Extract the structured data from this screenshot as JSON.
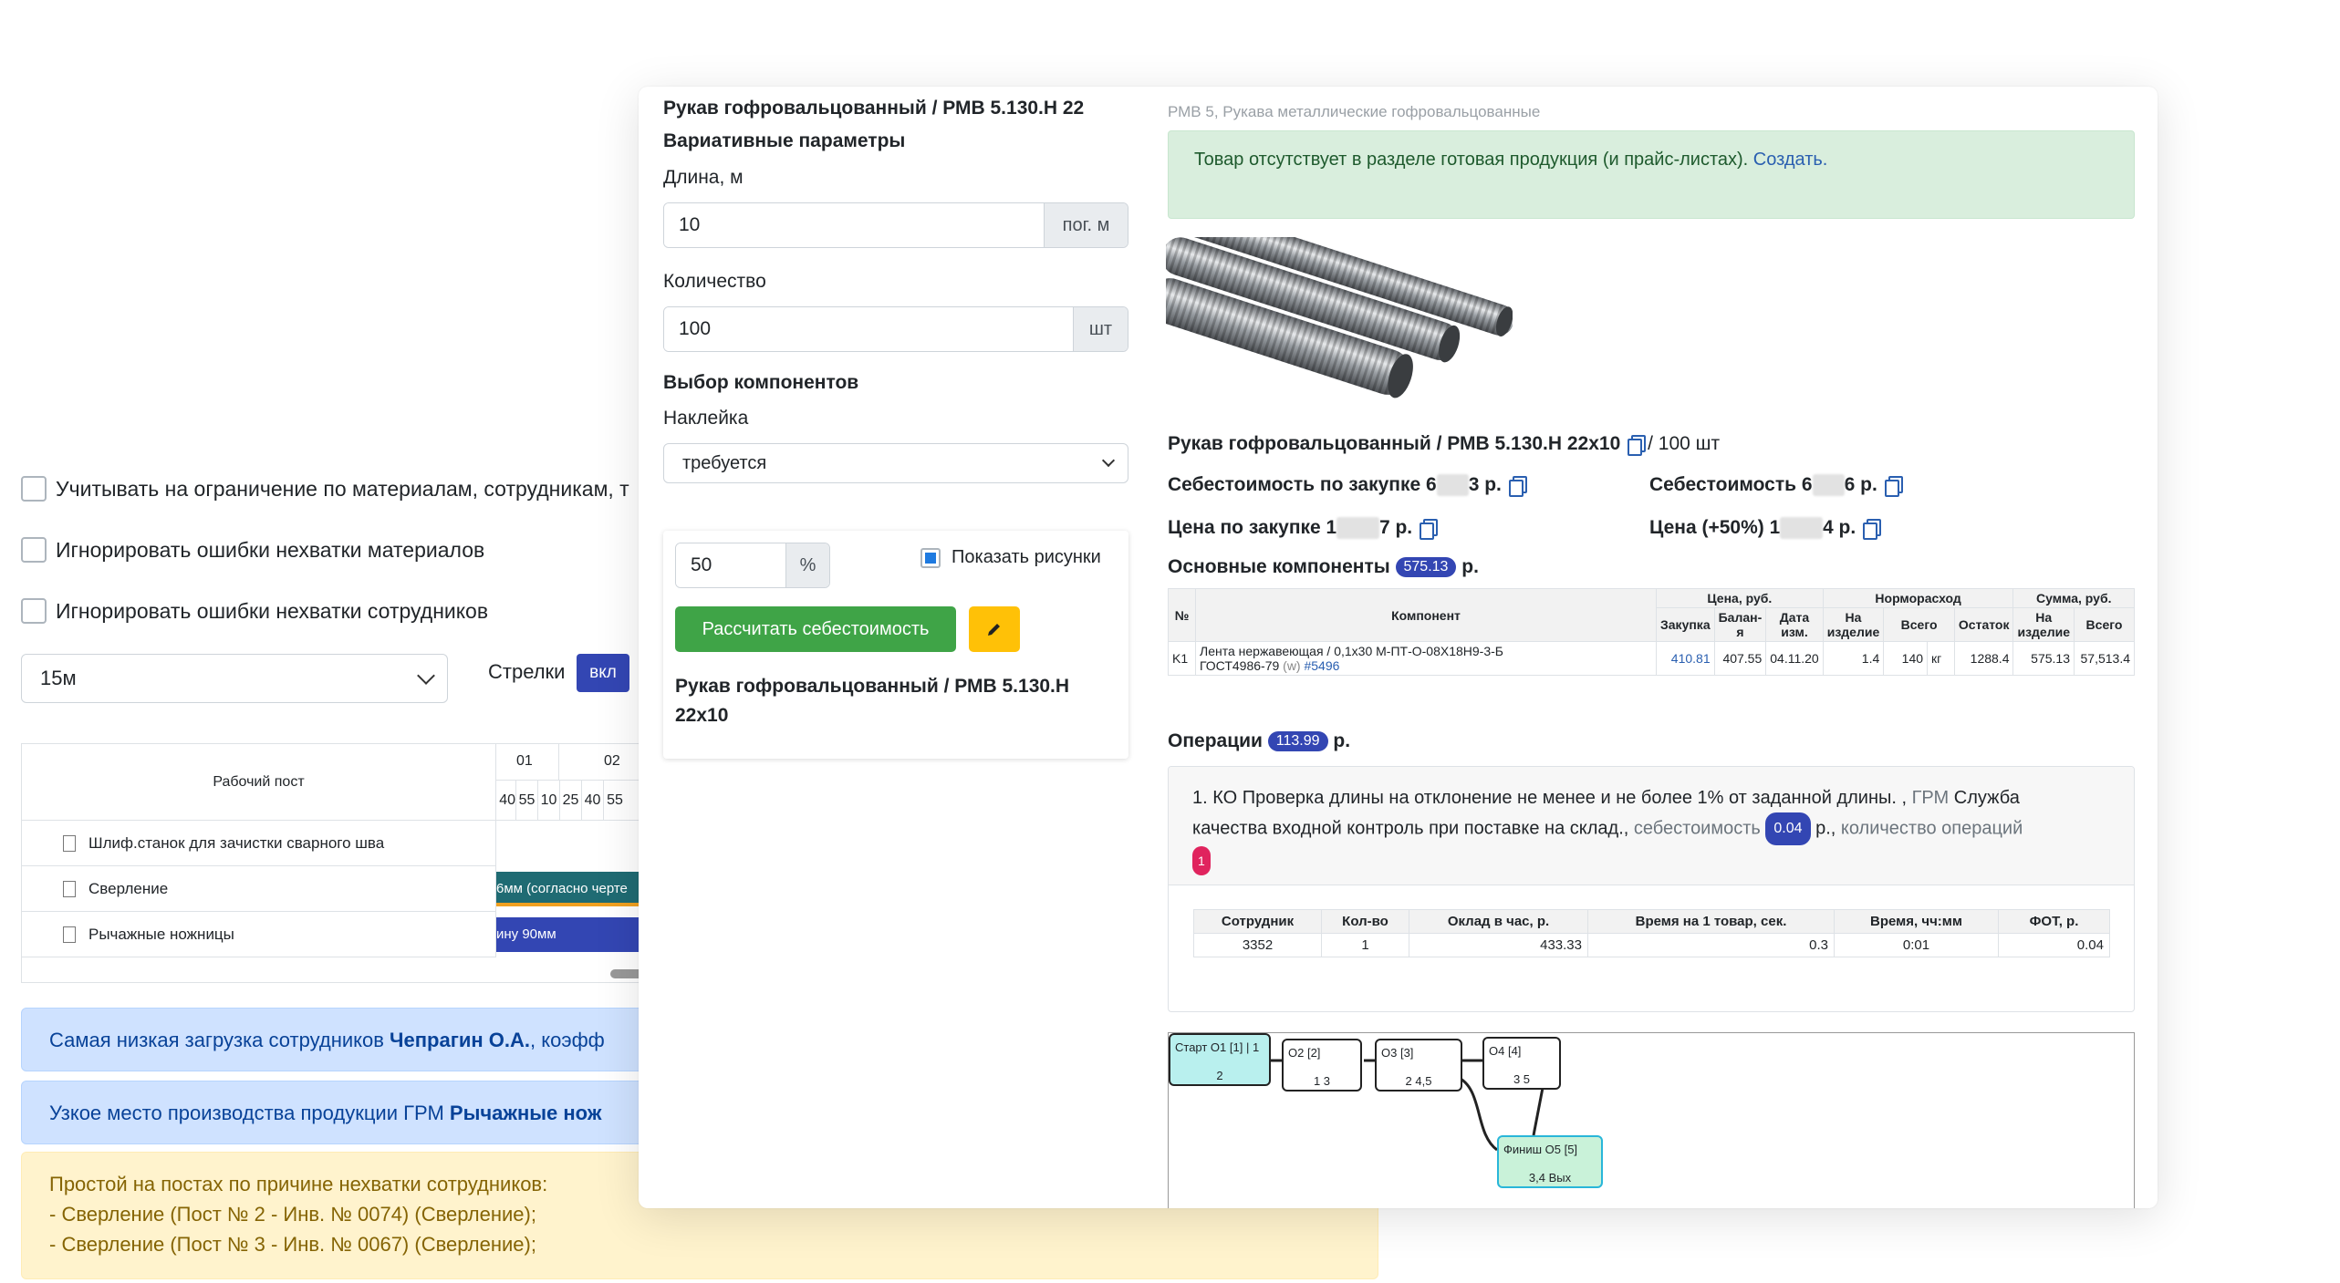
{
  "background": {
    "checkboxes": [
      "Учитывать на ограничение по материалам, сотрудникам, т",
      "Игнорировать ошибки нехватки материалов",
      "Игнорировать ошибки нехватки сотрудников"
    ],
    "interval_select": "15м",
    "arrows_label": "Стрелки",
    "arrows_toggle": "вкл",
    "gantt": {
      "header": "Рабочий пост",
      "hours": [
        "01",
        "02"
      ],
      "minutes": [
        "40",
        "55",
        "10",
        "25",
        "40",
        "55"
      ],
      "rows": [
        {
          "name": "Шлиф.станок для зачистки сварного шва",
          "bar": ""
        },
        {
          "name": "Сверление",
          "bar": "6мм (согласно черте"
        },
        {
          "name": "Рычажные ножницы",
          "bar": "ину 90мм"
        }
      ]
    },
    "alerts": {
      "lowest_load_prefix": "Самая низкая загрузка сотрудников ",
      "lowest_load_name": "Чепрагин О.А.",
      "lowest_load_suffix": ", коэфф",
      "bottleneck_prefix": "Узкое место производства продукции ГРМ ",
      "bottleneck_name": "Рычажные нож",
      "idle_lines": [
        "Простой на постах по причине нехватки сотрудников:",
        "- Сверление (Пост № 2 - Инв. № 0074) (Сверление);",
        "- Сверление (Пост № 3 - Инв. № 0067) (Сверление);"
      ]
    }
  },
  "modal": {
    "left": {
      "title": "Рукав гофровальцованный / РМВ 5.130.Н 22",
      "variative_params": "Вариативные параметры",
      "length_label": "Длина, м",
      "length_value": "10",
      "length_unit": "пог. м",
      "qty_label": "Количество",
      "qty_value": "100",
      "qty_unit": "шт",
      "components_title": "Выбор компонентов",
      "sticker_label": "Наклейка",
      "sticker_value": "требуется",
      "percent_value": "50",
      "percent_unit": "%",
      "show_images": "Показать рисунки",
      "calc_button": "Рассчитать себестоимость",
      "product_line1": "Рукав гофровальцованный / РМВ 5.130.Н",
      "product_line2": "22x10"
    },
    "right": {
      "breadcrumb": "РМВ 5, Рукава металлические гофровальцованные",
      "notice_text": "Товар отсутствует в разделе готовая продукция (и прайс-листах). ",
      "notice_link": "Создать.",
      "product_name": "Рукав гофровальцованный / РМВ 5.130.Н 22x10",
      "product_qty": " / 100 шт",
      "cost_purchase_label": "Себестоимость по закупке 6",
      "cost_purchase_hidden": "000",
      "cost_purchase_end": "3 р.",
      "cost_label": "Себестоимость 6",
      "cost_hidden": "000",
      "cost_end": "6 р.",
      "price_purchase_label": "Цена по закупке 1",
      "price_purchase_hidden": "0000",
      "price_purchase_end": "7 р.",
      "price_label": "Цена (+50%) 1",
      "price_hidden": "0000",
      "price_end": "4 р.",
      "main_components_label": "Основные компоненты ",
      "main_components_value": "575.13",
      "main_components_unit": " р.",
      "comp_table": {
        "h_num": "№",
        "h_component": "Компонент",
        "h_price": "Цена, руб.",
        "h_norm": "Норморасход",
        "h_sum": "Сумма, руб.",
        "h_purchase": "Закупка",
        "h_balance": "Балан-я",
        "h_date": "Дата изм.",
        "h_per_item": "На изделие",
        "h_total": "Всего",
        "h_rest": "Остаток",
        "h_sum_item": "На изделие",
        "h_sum_total": "Всего",
        "row": {
          "num": "K1",
          "name1": "Лента нержавеющая / 0,1х30 М-ПТ-О-08Х18Н9-3-Б",
          "name2": "ГОСТ4986-79 ",
          "w": "(w)",
          "link": "#5496",
          "purchase": "410.81",
          "balance": "407.55",
          "date": "04.11.20",
          "per_item": "1.4",
          "total": "140",
          "unit": "кг",
          "rest": "1288.4",
          "sum_item": "575.13",
          "sum_total": "57,513.4"
        }
      },
      "operations_label": "Операции ",
      "operations_value": "113.99",
      "operations_unit": " р.",
      "op": {
        "text1": "1. КО Проверка длины на отклонение не менее и не более 1% от заданной длины. , ",
        "grm": "ГРМ",
        "text2": " Служба",
        "text3": "качества входной контроль при поставке на склад., ",
        "cost_link": "себестоимость",
        "cost_value": "0.04",
        "text4": " р., ",
        "count_link": "количество операций",
        "count_value": "1"
      },
      "emp_table": {
        "headers": [
          "Сотрудник",
          "Кол-во",
          "Оклад в час, р.",
          "Время на 1 товар, сек.",
          "Время, чч:мм",
          "ФОТ, р."
        ],
        "row": [
          "3352",
          "1",
          "433.33",
          "0.3",
          "0:01",
          "0.04"
        ]
      },
      "flow": {
        "start": {
          "title": "Старт О1 [1] | 1",
          "bottom": "2"
        },
        "o2": {
          "title": "О2 [2]",
          "bottom": "1     3"
        },
        "o3": {
          "title": "О3 [3]",
          "bottom": "2    4,5"
        },
        "o4": {
          "title": "О4 [4]",
          "bottom": "3    5"
        },
        "finish": {
          "title": "Финиш О5 [5]",
          "bottom": "3,4    Вых"
        }
      }
    }
  }
}
